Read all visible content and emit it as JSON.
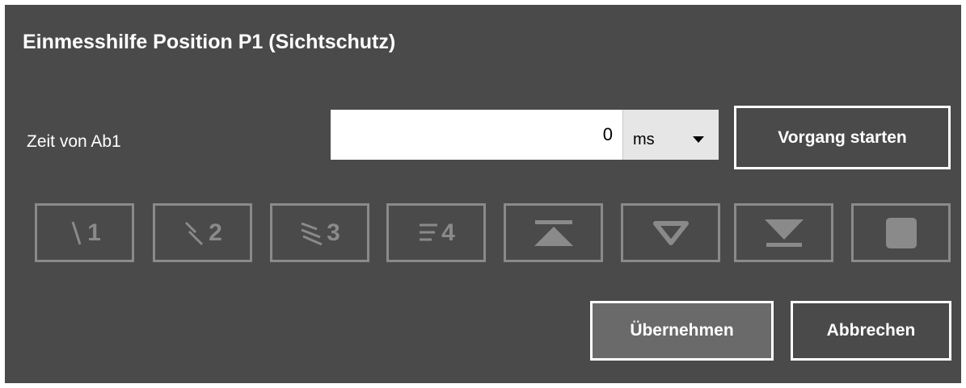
{
  "dialog": {
    "title": "Einmesshilfe Position P1 (Sichtschutz)"
  },
  "time_field": {
    "label": "Zeit von Ab1",
    "value": "0",
    "unit": "ms"
  },
  "buttons": {
    "start": "Vorgang starten",
    "apply": "Übernehmen",
    "cancel": "Abbrechen"
  },
  "toolbar": {
    "items": [
      {
        "icon": "tilt-1-icon",
        "number": "1"
      },
      {
        "icon": "tilt-2-icon",
        "number": "2"
      },
      {
        "icon": "tilt-3-icon",
        "number": "3"
      },
      {
        "icon": "tilt-4-icon",
        "number": "4"
      },
      {
        "icon": "move-up-icon"
      },
      {
        "icon": "move-down-icon"
      },
      {
        "icon": "move-bottom-icon"
      },
      {
        "icon": "stop-icon"
      }
    ],
    "disabled_color": "#8a8a8a"
  },
  "colors": {
    "dialog_background": "#4a4a4a",
    "text": "#ffffff",
    "border": "#ffffff",
    "disabled": "#8a8a8a"
  }
}
